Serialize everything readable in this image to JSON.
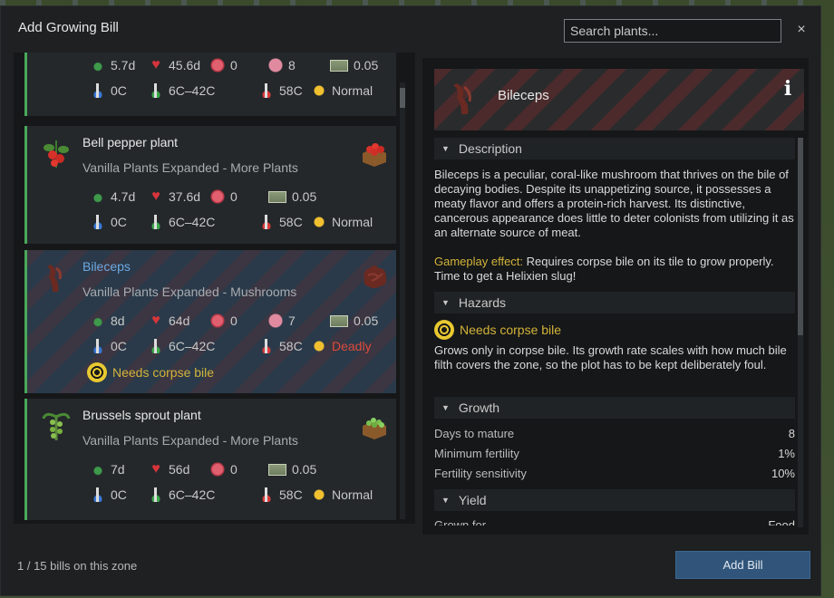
{
  "window": {
    "title": "Add Growing Bill",
    "search_placeholder": "Search plants...",
    "close_label": "×"
  },
  "plants": [
    {
      "name": "",
      "source": "",
      "days": "5.7d",
      "health": "45.6d",
      "yield": "0",
      "nutrition": "8",
      "market": "0.05",
      "min_temp": "0C",
      "opt_temp": "6C–42C",
      "max_temp": "58C",
      "light": "Normal",
      "light_color": "#c8c8c8"
    },
    {
      "name": "Bell pepper plant",
      "source": "Vanilla Plants Expanded - More Plants",
      "days": "4.7d",
      "health": "37.6d",
      "yield": "0",
      "market": "0.05",
      "min_temp": "0C",
      "opt_temp": "6C–42C",
      "max_temp": "58C",
      "light": "Normal",
      "light_color": "#c8c8c8"
    },
    {
      "name": "Bileceps",
      "source": "Vanilla Plants Expanded - Mushrooms",
      "days": "8d",
      "health": "64d",
      "yield": "0",
      "nutrition": "7",
      "market": "0.05",
      "min_temp": "0C",
      "opt_temp": "6C–42C",
      "max_temp": "58C",
      "light": "Deadly",
      "light_color": "#e04a3a",
      "hazard": "Needs corpse bile",
      "selected": true
    },
    {
      "name": "Brussels sprout plant",
      "source": "Vanilla Plants Expanded - More Plants",
      "days": "7d",
      "health": "56d",
      "yield": "0",
      "market": "0.05",
      "min_temp": "0C",
      "opt_temp": "6C–42C",
      "max_temp": "58C",
      "light": "Normal",
      "light_color": "#c8c8c8"
    }
  ],
  "detail": {
    "name": "Bileceps",
    "info_icon": "i",
    "description_header": "Description",
    "description": "Bileceps is a peculiar, coral-like mushroom that thrives on the bile of decaying bodies. Despite its unappetizing source, it possesses a meaty flavor and offers a protein-rich harvest. Its distinctive, cancerous appearance does little to deter colonists from utilizing it as an alternate source of meat.",
    "effect_label": "Gameplay effect:",
    "effect_text": " Requires corpse bile on its tile to grow properly. Time to get a Helixien slug!",
    "hazards_header": "Hazards",
    "hazard_name": "Needs corpse bile",
    "hazard_text": "Grows only in corpse bile. Its growth rate scales with how much bile filth covers the zone, so the plot has to be kept deliberately foul.",
    "growth_header": "Growth",
    "growth_rows": [
      {
        "label": "Days to mature",
        "value": "8"
      },
      {
        "label": "Minimum fertility",
        "value": "1%"
      },
      {
        "label": "Fertility sensitivity",
        "value": "10%"
      }
    ],
    "yield_header": "Yield",
    "yield_row": {
      "label": "Grown for",
      "value": "Food"
    }
  },
  "footer": {
    "count_text": "1 / 15 bills on this zone",
    "add_button": "Add Bill"
  },
  "colors": {
    "accent_green": "#4aa85a",
    "selected_name": "#6ea8e0",
    "hazard_yellow": "#d3b33a",
    "deadly_red": "#e04a3a",
    "button_blue": "#31557a"
  }
}
